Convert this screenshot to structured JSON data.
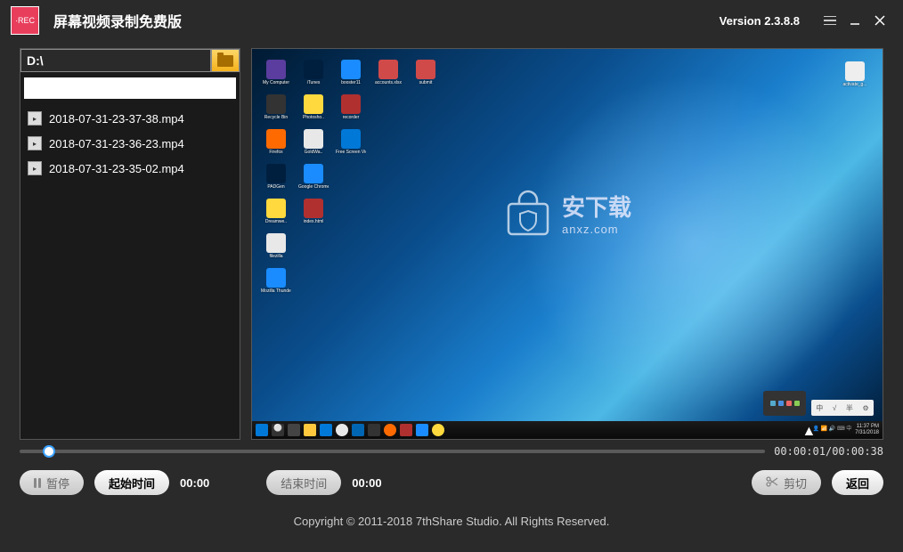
{
  "titlebar": {
    "app_title": "屏幕视频录制免费版",
    "version": "Version 2.3.8.8"
  },
  "sidebar": {
    "path": "D:\\",
    "files": [
      {
        "name": "2018-07-31-23-37-38.mp4"
      },
      {
        "name": "2018-07-31-23-36-23.mp4"
      },
      {
        "name": "2018-07-31-23-35-02.mp4"
      }
    ]
  },
  "preview": {
    "desktop_icons": [
      [
        "My Computer",
        "Recycle Bin",
        "Firefox",
        "PADGen",
        "Dreamwe..",
        "filezilla",
        "Mozilla Thunder..."
      ],
      [
        "iTunes",
        "Photosho..",
        "GoldWa..",
        "Google Chrome",
        "index.html"
      ],
      [
        "booster11",
        "recorder",
        "Free Screen Video Rec.."
      ],
      [
        "accounts.xlsx"
      ],
      [
        "submit"
      ]
    ],
    "right_icon": "activate_g...",
    "watermark_main": "安下载",
    "watermark_sub": "anxz.com",
    "taskbar_time": "11:37 PM",
    "taskbar_date": "7/31/2018"
  },
  "seek": {
    "current": "00:00:01",
    "total": "00:00:38",
    "progress_pct": 4
  },
  "controls": {
    "pause": "暂停",
    "start_time_label": "起始时间",
    "start_time": "00:00",
    "end_time_label": "结束时间",
    "end_time": "00:00",
    "cut": "剪切",
    "back": "返回"
  },
  "footer": "Copyright © 2011-2018 7thShare Studio. All Rights Reserved."
}
